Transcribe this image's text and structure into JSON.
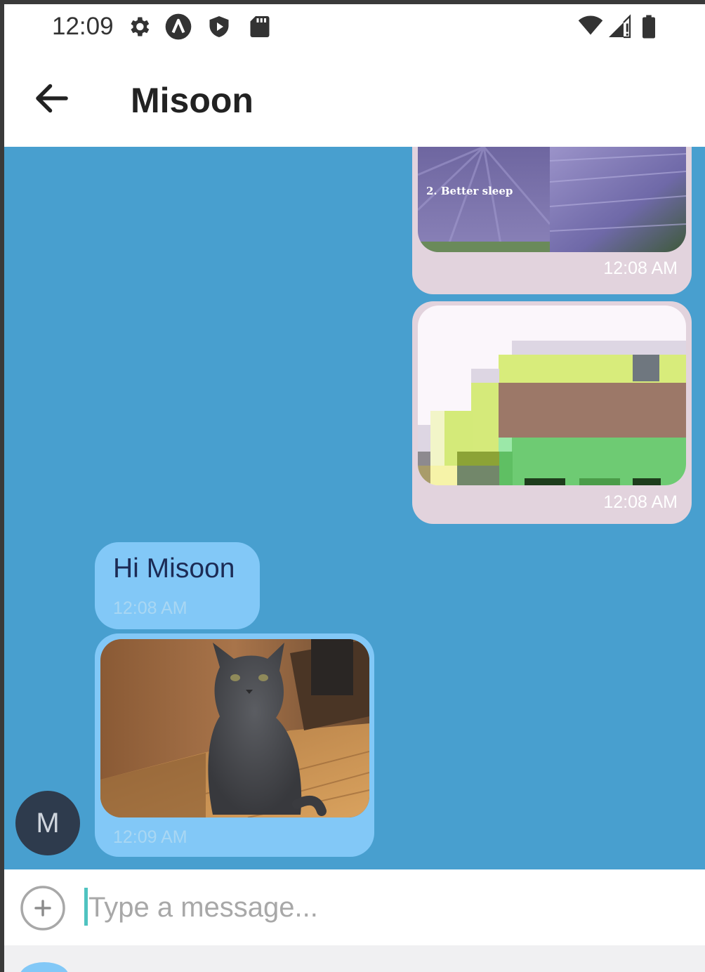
{
  "status_bar": {
    "time": "12:09",
    "left_icons": [
      "settings-icon",
      "app-a-icon",
      "shield-play-icon",
      "sd-card-icon"
    ],
    "right_icons": [
      "wifi-icon",
      "cell-signal-icon",
      "battery-icon"
    ]
  },
  "header": {
    "title": "Misoon",
    "back_icon": "arrow-left-icon"
  },
  "messages": [
    {
      "direction": "outgoing",
      "type": "image",
      "image_caption": "2. Better sleep",
      "time": "12:08 AM"
    },
    {
      "direction": "outgoing",
      "type": "image",
      "time": "12:08 AM"
    },
    {
      "direction": "incoming",
      "type": "text",
      "text": "Hi Misoon",
      "time": "12:08 AM"
    },
    {
      "direction": "incoming",
      "type": "image",
      "time": "12:09 AM"
    }
  ],
  "contact": {
    "avatar_initial": "M"
  },
  "composer": {
    "placeholder": "Type a message...",
    "value": "",
    "add_icon": "plus-circle-icon"
  },
  "colors": {
    "chat_background": "#489fcf",
    "outgoing_bubble": "#e2d3dd",
    "incoming_bubble": "#82c8f7",
    "avatar": "#2e3b4d",
    "caret": "#4fc3c0"
  }
}
